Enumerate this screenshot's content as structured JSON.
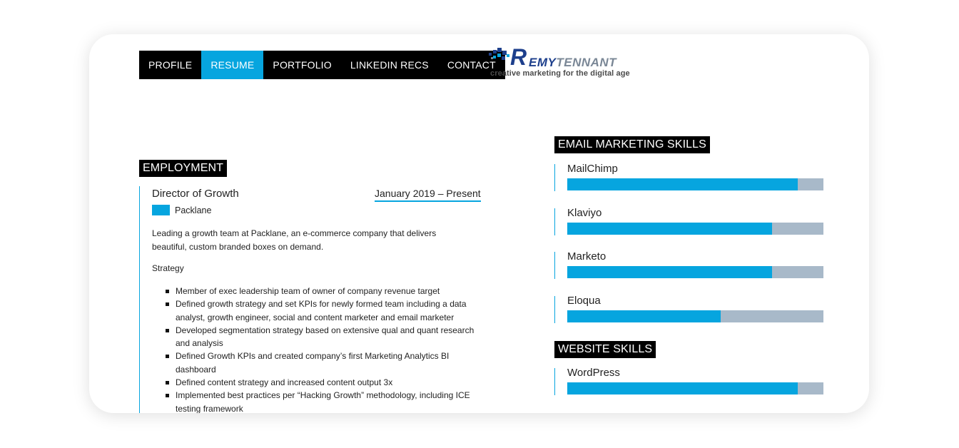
{
  "nav": {
    "items": [
      {
        "label": "PROFILE",
        "active": false
      },
      {
        "label": "RESUME",
        "active": true
      },
      {
        "label": "PORTFOLIO",
        "active": false
      },
      {
        "label": "LINKEDIN RECS",
        "active": false
      },
      {
        "label": "CONTACT",
        "active": false
      }
    ]
  },
  "logo": {
    "letter": "R",
    "name_part1": "EMY",
    "name_part2": "TENNANT",
    "tagline": "creative marketing for the digital age"
  },
  "employment": {
    "heading": "EMPLOYMENT",
    "job_title": "Director of Growth",
    "date": "January 2019 –  Present",
    "company": "Packlane",
    "description": "Leading a growth team at Packlane, an e-commerce company that delivers beautiful, custom branded boxes on demand.",
    "subheading": "Strategy",
    "bullets": [
      "Member of exec leadership team of owner of company revenue target",
      "Defined growth strategy and set KPIs for newly formed team including a data analyst, growth engineer, social and content marketer and email marketer",
      "Developed segmentation strategy based on extensive qual and quant research and analysis",
      "Defined Growth KPIs and created company’s first Marketing Analytics BI dashboard",
      "Defined content strategy and increased content output 3x",
      "Implemented best practices per “Hacking Growth” methodology, including ICE testing framework"
    ]
  },
  "email_skills": {
    "heading": "EMAIL MARKETING SKILLS",
    "skills": [
      {
        "name": "MailChimp",
        "level": 0.9
      },
      {
        "name": "Klaviyo",
        "level": 0.8
      },
      {
        "name": "Marketo",
        "level": 0.8
      },
      {
        "name": "Eloqua",
        "level": 0.6
      }
    ]
  },
  "website_skills": {
    "heading": "WEBSITE SKILLS",
    "skills": [
      {
        "name": "WordPress",
        "level": 0.9
      }
    ]
  },
  "colors": {
    "accent": "#06a5df",
    "track": "#a8b9c9",
    "nav_bg": "#000000"
  }
}
